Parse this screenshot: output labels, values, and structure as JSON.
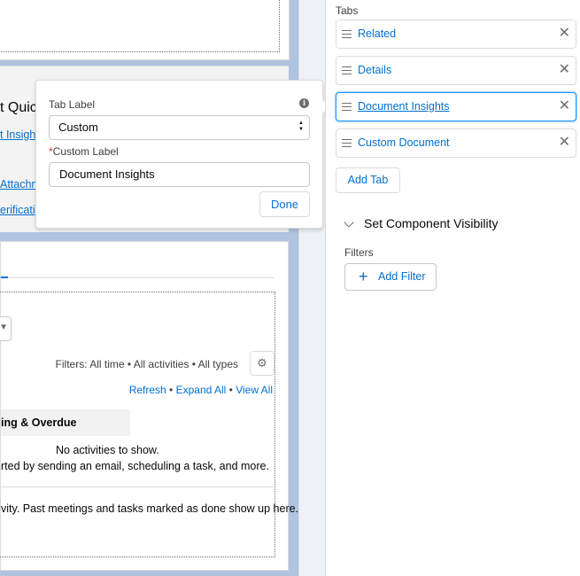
{
  "canvas": {
    "quick_title": "t Quick",
    "link_1": "t Insight",
    "link_2": "Attachm",
    "link_3": "erificati",
    "filters": "Filters: All time • All activities • All types",
    "links": {
      "refresh": "Refresh",
      "sep": " • ",
      "expand": "Expand All",
      "view": "View All"
    },
    "upcoming": "ing & Overdue",
    "no_activities": "No activities to show.",
    "get_started": "rted by sending an email, scheduling a task, and more.",
    "past_activity": "vity. Past meetings and tasks marked as done show up here."
  },
  "popover": {
    "tab_label_label": "Tab Label",
    "tab_label_value": "Custom",
    "required_mark": "*",
    "custom_label_label": "Custom Label",
    "custom_label_value": "Document Insights",
    "done": "Done",
    "info_glyph": "i"
  },
  "panel": {
    "tabs_label": "Tabs",
    "tabs": [
      {
        "label": "Related"
      },
      {
        "label": "Details"
      },
      {
        "label": "Document Insights"
      },
      {
        "label": "Custom Document"
      }
    ],
    "close_glyph": "✕",
    "add_tab": "Add Tab",
    "visibility_title": "Set Component Visibility",
    "filters_label": "Filters",
    "add_filter": "Add Filter",
    "plus_glyph": "+"
  },
  "colors": {
    "link": "#0070d2",
    "canvas_bg": "#b0c4df",
    "focus": "#1b96ff"
  }
}
